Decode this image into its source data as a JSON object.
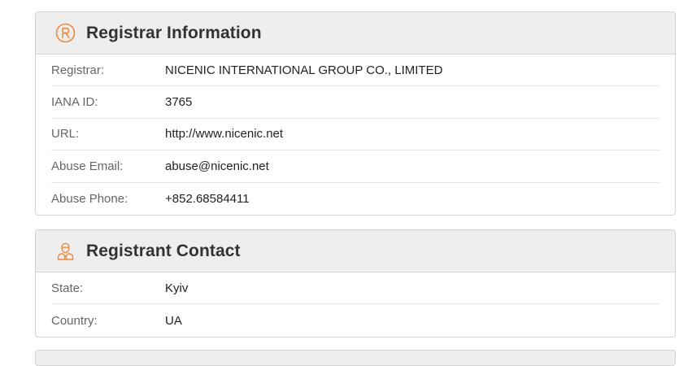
{
  "registrar_section": {
    "title": "Registrar Information",
    "icon": "registered-icon",
    "rows": [
      {
        "label": "Registrar:",
        "value": "NICENIC INTERNATIONAL GROUP CO., LIMITED"
      },
      {
        "label": "IANA ID:",
        "value": "3765"
      },
      {
        "label": "URL:",
        "value": "http://www.nicenic.net"
      },
      {
        "label": "Abuse Email:",
        "value": "abuse@nicenic.net"
      },
      {
        "label": "Abuse Phone:",
        "value": "+852.68584411"
      }
    ]
  },
  "registrant_section": {
    "title": "Registrant Contact",
    "icon": "person-icon",
    "rows": [
      {
        "label": "State:",
        "value": "Kyiv"
      },
      {
        "label": "Country:",
        "value": "UA"
      }
    ]
  },
  "colors": {
    "accent": "#f0883e",
    "header_bg": "#eeeeee",
    "border": "#d3d3d3"
  }
}
